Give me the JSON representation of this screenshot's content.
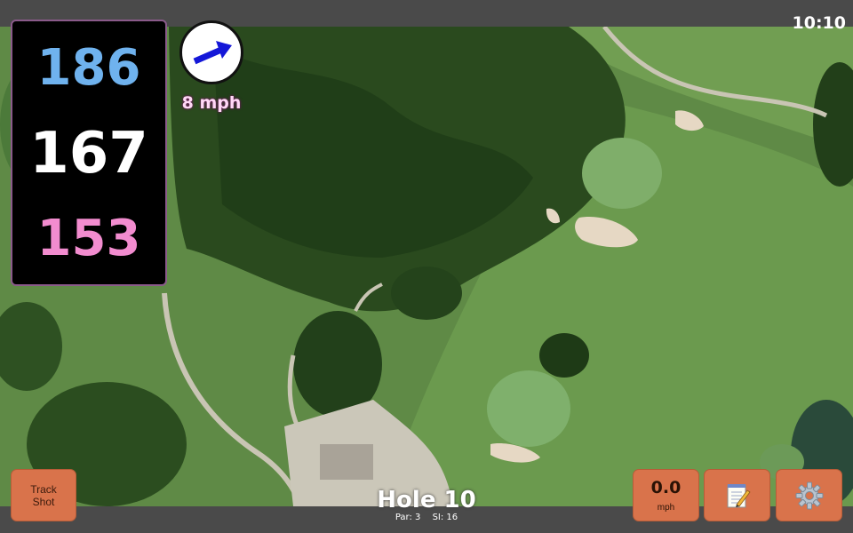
{
  "status": {
    "time": "10:10"
  },
  "distances": {
    "back": "186",
    "center": "167",
    "front": "153"
  },
  "wind": {
    "speed": "8 mph",
    "direction_icon": "wind-arrow-icon"
  },
  "buttons": {
    "track_shot_line1": "Track",
    "track_shot_line2": "Shot",
    "speed_value": "0.0",
    "speed_unit": "mph",
    "notes_icon": "notepad-icon",
    "settings_icon": "gear-icon"
  },
  "hole": {
    "title": "Hole 10",
    "par": "Par: 3",
    "si": "SI: 16"
  },
  "colors": {
    "back_distance": "#6fb2ee",
    "center_distance": "#ffffff",
    "front_distance": "#f28ccf",
    "button": "#d9734b",
    "bar": "#4a4a4a"
  }
}
